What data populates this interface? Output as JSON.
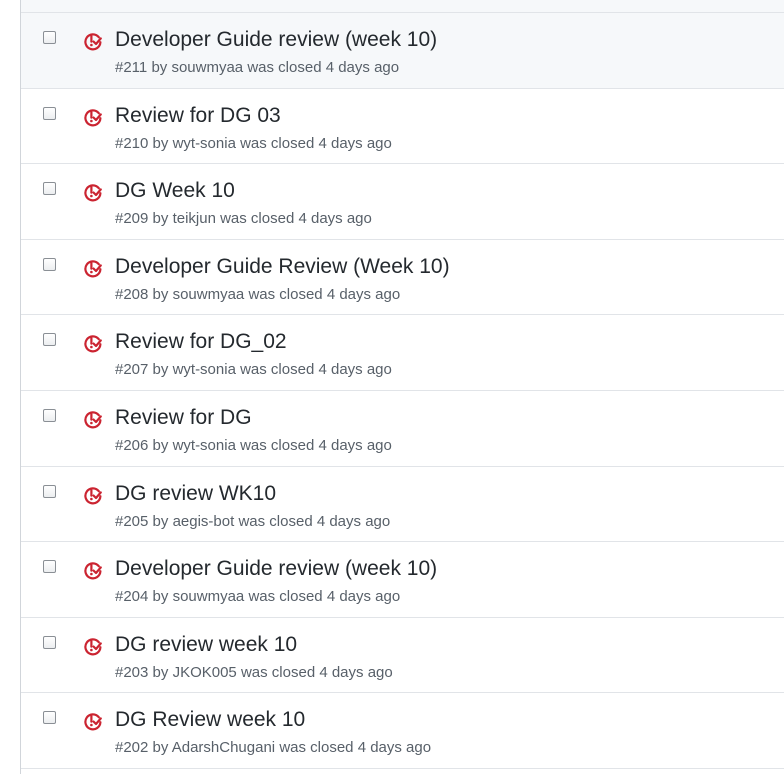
{
  "colors": {
    "closed_icon": "#cb2431",
    "title": "#24292e",
    "meta": "#586069"
  },
  "issues": [
    {
      "title": "Developer Guide review (week 10)",
      "number": "#211",
      "by": "by",
      "author": "souwmyaa",
      "status": "was closed",
      "time": "4 days ago",
      "state_icon": "issue-closed-icon"
    },
    {
      "title": "Review for DG 03",
      "number": "#210",
      "by": "by",
      "author": "wyt-sonia",
      "status": "was closed",
      "time": "4 days ago",
      "state_icon": "issue-closed-icon"
    },
    {
      "title": "DG Week 10",
      "number": "#209",
      "by": "by",
      "author": "teikjun",
      "status": "was closed",
      "time": "4 days ago",
      "state_icon": "issue-closed-icon"
    },
    {
      "title": "Developer Guide Review (Week 10)",
      "number": "#208",
      "by": "by",
      "author": "souwmyaa",
      "status": "was closed",
      "time": "4 days ago",
      "state_icon": "issue-closed-icon"
    },
    {
      "title": "Review for DG_02",
      "number": "#207",
      "by": "by",
      "author": "wyt-sonia",
      "status": "was closed",
      "time": "4 days ago",
      "state_icon": "issue-closed-icon"
    },
    {
      "title": "Review for DG",
      "number": "#206",
      "by": "by",
      "author": "wyt-sonia",
      "status": "was closed",
      "time": "4 days ago",
      "state_icon": "issue-closed-icon"
    },
    {
      "title": "DG review WK10",
      "number": "#205",
      "by": "by",
      "author": "aegis-bot",
      "status": "was closed",
      "time": "4 days ago",
      "state_icon": "issue-closed-icon"
    },
    {
      "title": "Developer Guide review (week 10)",
      "number": "#204",
      "by": "by",
      "author": "souwmyaa",
      "status": "was closed",
      "time": "4 days ago",
      "state_icon": "issue-closed-icon"
    },
    {
      "title": "DG review week 10",
      "number": "#203",
      "by": "by",
      "author": "JKOK005",
      "status": "was closed",
      "time": "4 days ago",
      "state_icon": "issue-closed-icon"
    },
    {
      "title": "DG Review week 10",
      "number": "#202",
      "by": "by",
      "author": "AdarshChugani",
      "status": "was closed",
      "time": "4 days ago",
      "state_icon": "issue-closed-icon"
    }
  ]
}
